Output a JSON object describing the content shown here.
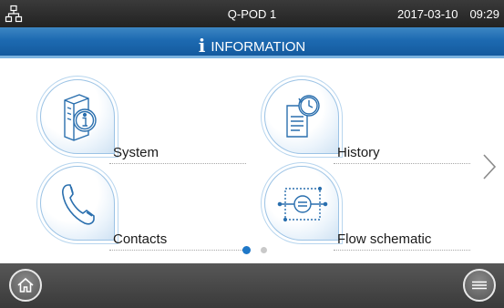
{
  "status": {
    "network_icon": "network-icon",
    "device_name": "Q-POD 1",
    "date": "2017-03-10",
    "time": "09:29"
  },
  "header": {
    "icon": "info-icon",
    "info_glyph": "i",
    "title": "INFORMATION"
  },
  "tiles": [
    {
      "label": "System",
      "icon": "system-info-icon"
    },
    {
      "label": "History",
      "icon": "history-icon"
    },
    {
      "label": "Contacts",
      "icon": "phone-icon"
    },
    {
      "label": "Flow schematic",
      "icon": "flow-schematic-icon"
    }
  ],
  "pager": {
    "current_page": 1,
    "total_pages": 2,
    "next_icon": "chevron-right-icon"
  },
  "footer": {
    "home_icon": "home-icon",
    "menu_icon": "menu-icon"
  },
  "colors": {
    "accent": "#1f78c8",
    "header_blue": "#1d6ab1",
    "icon_stroke": "#2a6fae",
    "status_bg": "#2a2a2a",
    "footer_bg": "#4a4a4a"
  }
}
